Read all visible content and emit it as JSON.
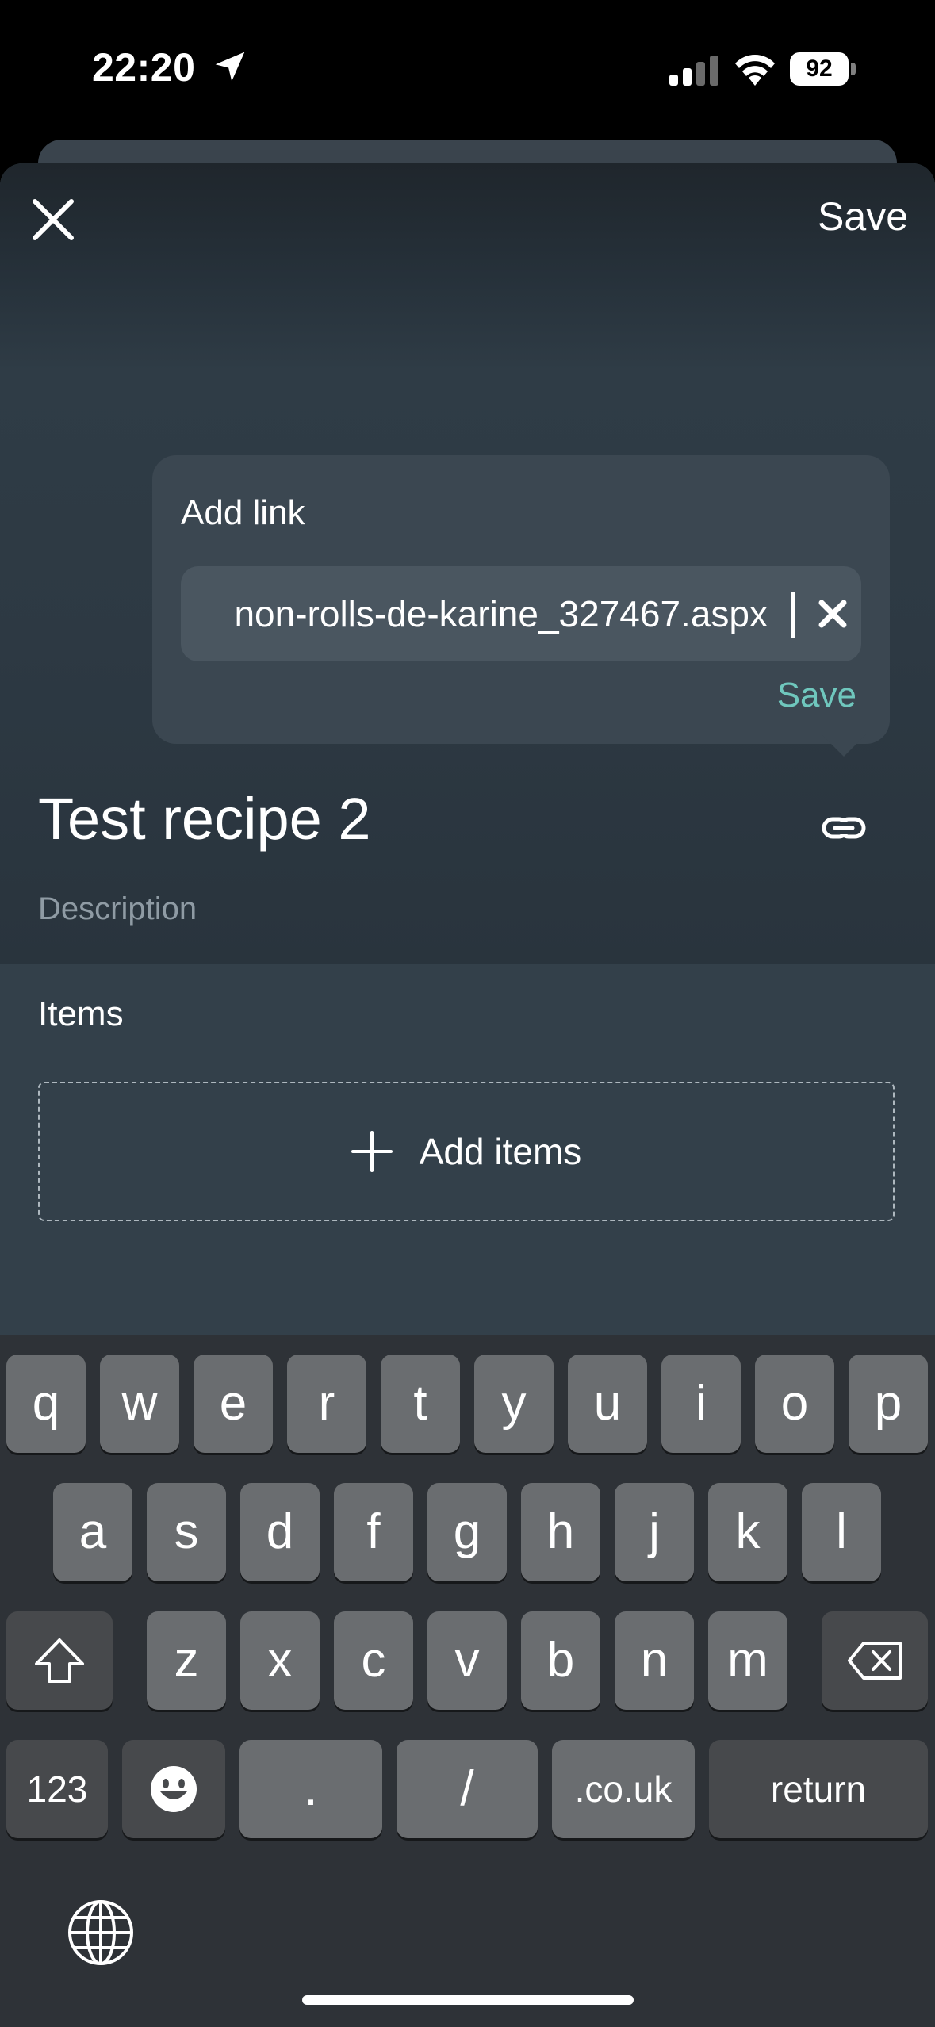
{
  "status_bar": {
    "time": "22:20",
    "battery": "92"
  },
  "header": {
    "save_label": "Save"
  },
  "add_link_popup": {
    "title": "Add link",
    "url_value": "non-rolls-de-karine_327467.aspx",
    "save_label": "Save"
  },
  "recipe": {
    "title": "Test recipe 2",
    "description_placeholder": "Description"
  },
  "items": {
    "label": "Items",
    "add_label": "Add items"
  },
  "keyboard": {
    "row1": [
      "q",
      "w",
      "e",
      "r",
      "t",
      "y",
      "u",
      "i",
      "o",
      "p"
    ],
    "row2": [
      "a",
      "s",
      "d",
      "f",
      "g",
      "h",
      "j",
      "k",
      "l"
    ],
    "row3": [
      "z",
      "x",
      "c",
      "v",
      "b",
      "n",
      "m"
    ],
    "num_label": "123",
    "dot_label": ".",
    "slash_label": "/",
    "domain_label": ".co.uk",
    "return_label": "return"
  },
  "colors": {
    "accent": "#6fc7bd",
    "sheet": "#33404a",
    "popup": "#3b4751"
  }
}
